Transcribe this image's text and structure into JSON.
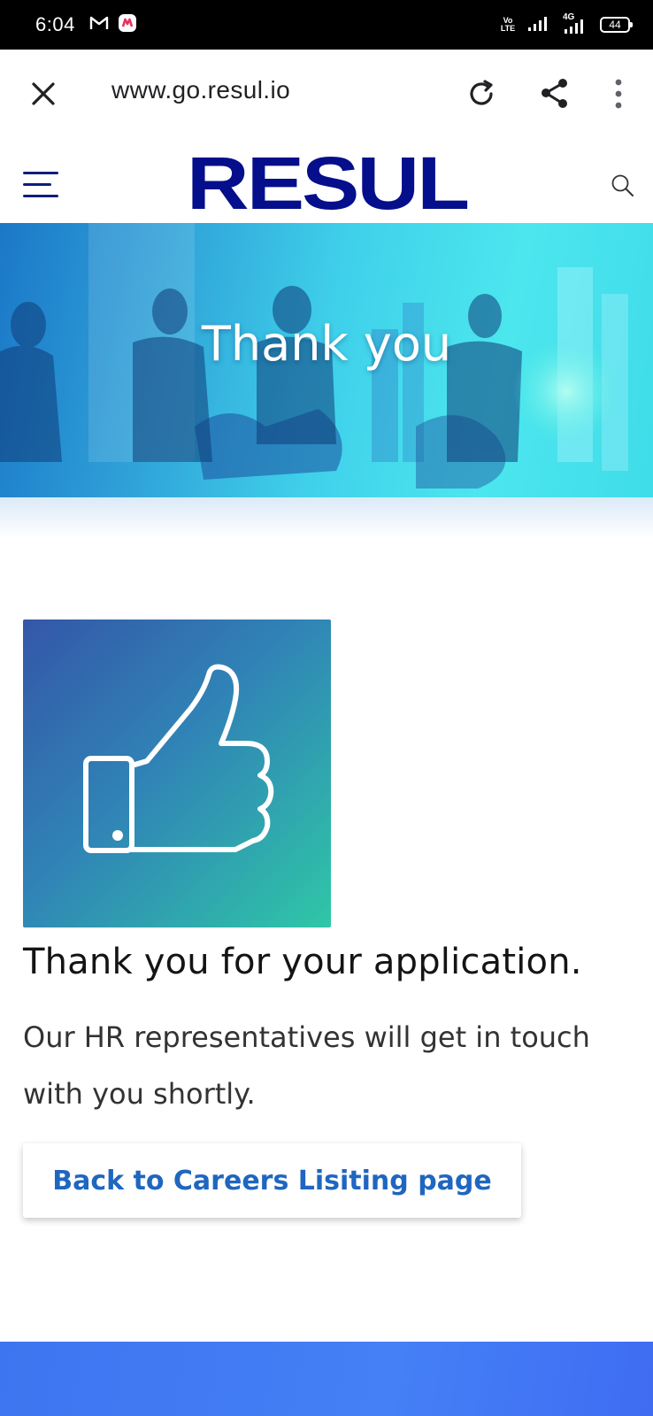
{
  "status_bar": {
    "time": "6:04",
    "network_label": "4G",
    "volte_top": "Vo",
    "volte_bottom": "LTE",
    "battery": "44",
    "icons": [
      "gmail-icon",
      "app-notification-icon",
      "signal-icon",
      "battery-icon"
    ]
  },
  "browser": {
    "url": "www.go.resul.io",
    "icons": [
      "close-icon",
      "reload-icon",
      "share-icon",
      "more-vert-icon"
    ]
  },
  "site_header": {
    "logo_text": "RESUL",
    "logo_color": "#050f8c",
    "icons": [
      "hamburger-menu-icon",
      "search-icon"
    ]
  },
  "hero": {
    "title": "Thank you"
  },
  "content": {
    "icon": "thumbs-up-icon",
    "heading": "Thank you for your application.",
    "message": "Our HR representatives will get in touch with you shortly.",
    "back_button_label": "Back to Careers Lisiting page",
    "link_color": "#1f66c0"
  }
}
